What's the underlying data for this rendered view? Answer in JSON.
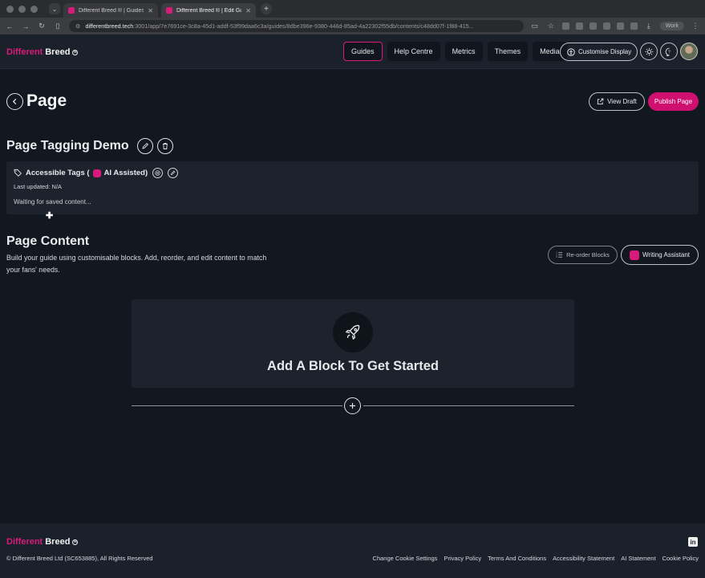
{
  "browser": {
    "tabs": [
      {
        "title": "Different Breed ® | Guides | D"
      },
      {
        "title": "Different Breed ® | Edit Guide"
      }
    ],
    "url_host": "differentbreed.tech",
    "url_path": ":3001/app/7e7691ce-3c8a-45d1-addf-53f99daa6c3a/guides/8dbe396e-9380-446d-85ad-4a22302f55db/contents/c48dd07f-1f88-415...",
    "profile_label": "Work"
  },
  "header": {
    "logo_part1": "Different",
    "logo_part2": "Breed",
    "nav": [
      "Guides",
      "Help Centre",
      "Metrics",
      "Themes",
      "Media"
    ],
    "customise_label": "Customise Display"
  },
  "page": {
    "title": "Page",
    "view_draft_label": "View Draft",
    "publish_label": "Publish Page",
    "guide_title": "Page Tagging Demo"
  },
  "tags": {
    "heading": "Accessible Tags (",
    "heading_suffix": "AI Assisted)",
    "last_updated": "Last updated: N/A",
    "waiting": "Waiting for saved content..."
  },
  "content": {
    "title": "Page Content",
    "description": "Build your guide using customisable blocks. Add, reorder, and edit content to match your fans' needs.",
    "reorder_label": "Re-order Blocks",
    "writing_label": "Writing Assistant",
    "empty_title": "Add A Block To Get Started"
  },
  "footer": {
    "logo_part1": "Different",
    "logo_part2": "Breed",
    "copyright": "© Different Breed Ltd (SC653885), All Rights Reserved",
    "links": [
      "Change Cookie Settings",
      "Privacy Policy",
      "Terms And Conditions",
      "Accessibility Statement",
      "AI Statement",
      "Cookie Policy"
    ]
  },
  "colors": {
    "brand": "#d81b7a",
    "background": "#121820",
    "card": "#1d232d"
  }
}
